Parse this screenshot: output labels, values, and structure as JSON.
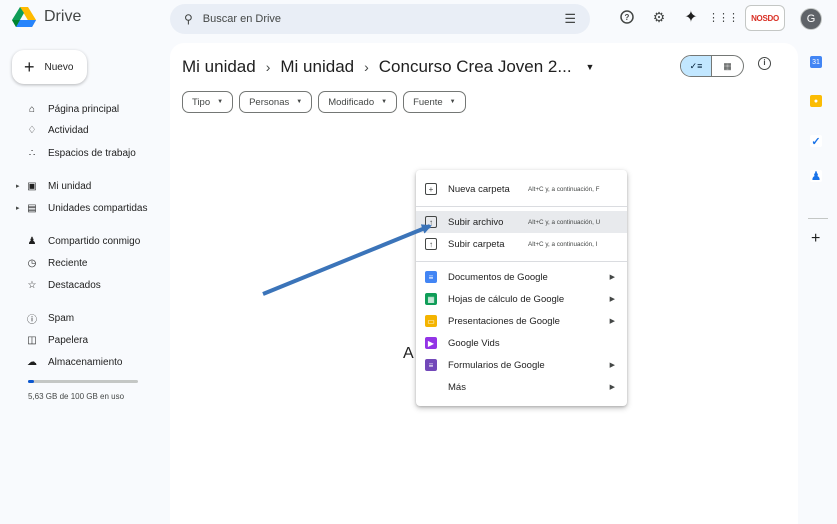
{
  "app": {
    "name": "Drive"
  },
  "search": {
    "placeholder": "Buscar en Drive"
  },
  "header": {
    "brand_logo": "NOSDO",
    "avatar_initial": "G"
  },
  "sidebar": {
    "new_label": "Nuevo",
    "items": [
      {
        "label": "Página principal",
        "icon": "home-icon"
      },
      {
        "label": "Actividad",
        "icon": "bell-icon"
      },
      {
        "label": "Espacios de trabajo",
        "icon": "workspaces-icon"
      },
      {
        "label": "Mi unidad",
        "icon": "my-drive-icon"
      },
      {
        "label": "Unidades compartidas",
        "icon": "shared-drives-icon"
      },
      {
        "label": "Compartido conmigo",
        "icon": "people-icon"
      },
      {
        "label": "Reciente",
        "icon": "clock-icon"
      },
      {
        "label": "Destacados",
        "icon": "star-icon"
      },
      {
        "label": "Spam",
        "icon": "spam-icon"
      },
      {
        "label": "Papelera",
        "icon": "trash-icon"
      },
      {
        "label": "Almacenamiento",
        "icon": "cloud-icon"
      }
    ],
    "storage_text": "5,63 GB de 100 GB en uso",
    "storage_used_fraction": 0.056
  },
  "breadcrumb": {
    "root": "Mi unidad",
    "parent": "Mi unidad",
    "current": "Concurso Crea Joven 2..."
  },
  "filters": [
    "Tipo",
    "Personas",
    "Modificado",
    "Fuente"
  ],
  "main": {
    "peek_letter": "A"
  },
  "context_menu": {
    "items": [
      {
        "label": "Nueva carpeta",
        "shortcut": "Alt+C y, a continuación, F",
        "icon": "new-folder-icon"
      },
      {
        "label": "Subir archivo",
        "shortcut": "Alt+C y, a continuación, U",
        "icon": "upload-file-icon",
        "active": true
      },
      {
        "label": "Subir carpeta",
        "shortcut": "Alt+C y, a continuación, I",
        "icon": "upload-folder-icon"
      },
      {
        "label": "Documentos de Google",
        "icon": "docs-icon",
        "color": "#4285f4",
        "submenu": true
      },
      {
        "label": "Hojas de cálculo de Google",
        "icon": "sheets-icon",
        "color": "#0f9d58",
        "submenu": true
      },
      {
        "label": "Presentaciones de Google",
        "icon": "slides-icon",
        "color": "#f4b400",
        "submenu": true
      },
      {
        "label": "Google Vids",
        "icon": "vids-icon",
        "color": "#9334e6",
        "submenu": false
      },
      {
        "label": "Formularios de Google",
        "icon": "forms-icon",
        "color": "#7248b9",
        "submenu": true
      },
      {
        "label": "Más",
        "icon": "",
        "submenu": true
      }
    ]
  },
  "colors": {
    "accent": "#0b57d0",
    "arrow": "#3b74b9",
    "toggle_active": "#c2e7ff"
  }
}
